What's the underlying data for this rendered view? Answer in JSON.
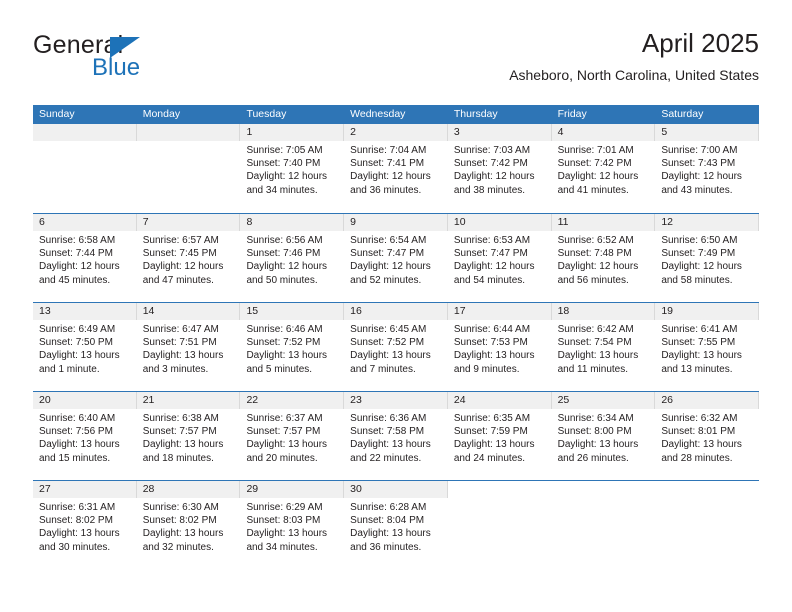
{
  "brand": {
    "name_top": "General",
    "name_bottom": "Blue",
    "triangle_color": "#1d72b8"
  },
  "header": {
    "title": "April 2025",
    "subtitle": "Asheboro, North Carolina, United States",
    "accent_color": "#2e75b6"
  },
  "calendar": {
    "weekday_headers": [
      "Sunday",
      "Monday",
      "Tuesday",
      "Wednesday",
      "Thursday",
      "Friday",
      "Saturday"
    ],
    "weeks": [
      [
        {
          "day": "",
          "blank": true,
          "lines": []
        },
        {
          "day": "",
          "blank": true,
          "lines": []
        },
        {
          "day": "1",
          "lines": [
            "Sunrise: 7:05 AM",
            "Sunset: 7:40 PM",
            "Daylight: 12 hours",
            "and 34 minutes."
          ]
        },
        {
          "day": "2",
          "lines": [
            "Sunrise: 7:04 AM",
            "Sunset: 7:41 PM",
            "Daylight: 12 hours",
            "and 36 minutes."
          ]
        },
        {
          "day": "3",
          "lines": [
            "Sunrise: 7:03 AM",
            "Sunset: 7:42 PM",
            "Daylight: 12 hours",
            "and 38 minutes."
          ]
        },
        {
          "day": "4",
          "lines": [
            "Sunrise: 7:01 AM",
            "Sunset: 7:42 PM",
            "Daylight: 12 hours",
            "and 41 minutes."
          ]
        },
        {
          "day": "5",
          "lines": [
            "Sunrise: 7:00 AM",
            "Sunset: 7:43 PM",
            "Daylight: 12 hours",
            "and 43 minutes."
          ]
        }
      ],
      [
        {
          "day": "6",
          "lines": [
            "Sunrise: 6:58 AM",
            "Sunset: 7:44 PM",
            "Daylight: 12 hours",
            "and 45 minutes."
          ]
        },
        {
          "day": "7",
          "lines": [
            "Sunrise: 6:57 AM",
            "Sunset: 7:45 PM",
            "Daylight: 12 hours",
            "and 47 minutes."
          ]
        },
        {
          "day": "8",
          "lines": [
            "Sunrise: 6:56 AM",
            "Sunset: 7:46 PM",
            "Daylight: 12 hours",
            "and 50 minutes."
          ]
        },
        {
          "day": "9",
          "lines": [
            "Sunrise: 6:54 AM",
            "Sunset: 7:47 PM",
            "Daylight: 12 hours",
            "and 52 minutes."
          ]
        },
        {
          "day": "10",
          "lines": [
            "Sunrise: 6:53 AM",
            "Sunset: 7:47 PM",
            "Daylight: 12 hours",
            "and 54 minutes."
          ]
        },
        {
          "day": "11",
          "lines": [
            "Sunrise: 6:52 AM",
            "Sunset: 7:48 PM",
            "Daylight: 12 hours",
            "and 56 minutes."
          ]
        },
        {
          "day": "12",
          "lines": [
            "Sunrise: 6:50 AM",
            "Sunset: 7:49 PM",
            "Daylight: 12 hours",
            "and 58 minutes."
          ]
        }
      ],
      [
        {
          "day": "13",
          "lines": [
            "Sunrise: 6:49 AM",
            "Sunset: 7:50 PM",
            "Daylight: 13 hours",
            "and 1 minute."
          ]
        },
        {
          "day": "14",
          "lines": [
            "Sunrise: 6:47 AM",
            "Sunset: 7:51 PM",
            "Daylight: 13 hours",
            "and 3 minutes."
          ]
        },
        {
          "day": "15",
          "lines": [
            "Sunrise: 6:46 AM",
            "Sunset: 7:52 PM",
            "Daylight: 13 hours",
            "and 5 minutes."
          ]
        },
        {
          "day": "16",
          "lines": [
            "Sunrise: 6:45 AM",
            "Sunset: 7:52 PM",
            "Daylight: 13 hours",
            "and 7 minutes."
          ]
        },
        {
          "day": "17",
          "lines": [
            "Sunrise: 6:44 AM",
            "Sunset: 7:53 PM",
            "Daylight: 13 hours",
            "and 9 minutes."
          ]
        },
        {
          "day": "18",
          "lines": [
            "Sunrise: 6:42 AM",
            "Sunset: 7:54 PM",
            "Daylight: 13 hours",
            "and 11 minutes."
          ]
        },
        {
          "day": "19",
          "lines": [
            "Sunrise: 6:41 AM",
            "Sunset: 7:55 PM",
            "Daylight: 13 hours",
            "and 13 minutes."
          ]
        }
      ],
      [
        {
          "day": "20",
          "lines": [
            "Sunrise: 6:40 AM",
            "Sunset: 7:56 PM",
            "Daylight: 13 hours",
            "and 15 minutes."
          ]
        },
        {
          "day": "21",
          "lines": [
            "Sunrise: 6:38 AM",
            "Sunset: 7:57 PM",
            "Daylight: 13 hours",
            "and 18 minutes."
          ]
        },
        {
          "day": "22",
          "lines": [
            "Sunrise: 6:37 AM",
            "Sunset: 7:57 PM",
            "Daylight: 13 hours",
            "and 20 minutes."
          ]
        },
        {
          "day": "23",
          "lines": [
            "Sunrise: 6:36 AM",
            "Sunset: 7:58 PM",
            "Daylight: 13 hours",
            "and 22 minutes."
          ]
        },
        {
          "day": "24",
          "lines": [
            "Sunrise: 6:35 AM",
            "Sunset: 7:59 PM",
            "Daylight: 13 hours",
            "and 24 minutes."
          ]
        },
        {
          "day": "25",
          "lines": [
            "Sunrise: 6:34 AM",
            "Sunset: 8:00 PM",
            "Daylight: 13 hours",
            "and 26 minutes."
          ]
        },
        {
          "day": "26",
          "lines": [
            "Sunrise: 6:32 AM",
            "Sunset: 8:01 PM",
            "Daylight: 13 hours",
            "and 28 minutes."
          ]
        }
      ],
      [
        {
          "day": "27",
          "lines": [
            "Sunrise: 6:31 AM",
            "Sunset: 8:02 PM",
            "Daylight: 13 hours",
            "and 30 minutes."
          ]
        },
        {
          "day": "28",
          "lines": [
            "Sunrise: 6:30 AM",
            "Sunset: 8:02 PM",
            "Daylight: 13 hours",
            "and 32 minutes."
          ]
        },
        {
          "day": "29",
          "lines": [
            "Sunrise: 6:29 AM",
            "Sunset: 8:03 PM",
            "Daylight: 13 hours",
            "and 34 minutes."
          ]
        },
        {
          "day": "30",
          "lines": [
            "Sunrise: 6:28 AM",
            "Sunset: 8:04 PM",
            "Daylight: 13 hours",
            "and 36 minutes."
          ]
        },
        {
          "day": "",
          "empty": true,
          "lines": []
        },
        {
          "day": "",
          "empty": true,
          "lines": []
        },
        {
          "day": "",
          "empty": true,
          "lines": []
        }
      ]
    ]
  }
}
